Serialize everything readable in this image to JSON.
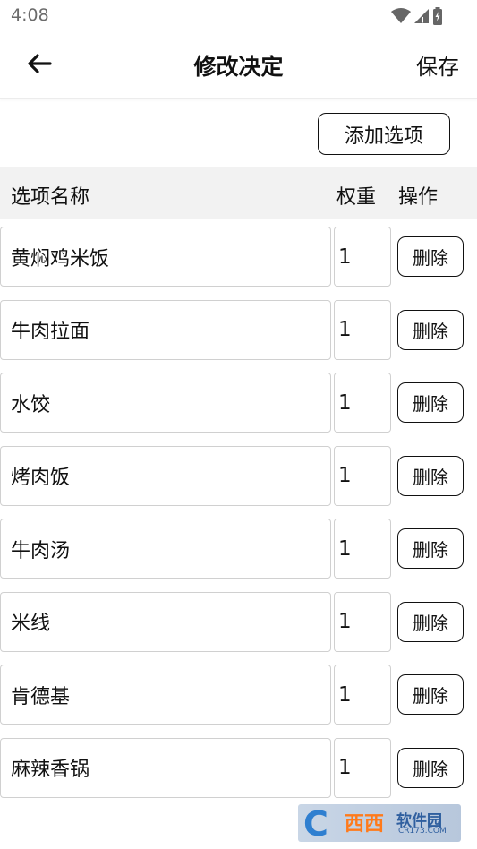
{
  "status_bar": {
    "time": "4:08",
    "icons": [
      "wifi-icon",
      "signal-icon",
      "battery-icon"
    ]
  },
  "app_bar": {
    "back_icon": "arrow-left-icon",
    "title": "修改决定",
    "save_label": "保存"
  },
  "toolbar": {
    "add_option_label": "添加选项"
  },
  "table": {
    "headers": {
      "name": "选项名称",
      "weight": "权重",
      "action": "操作"
    },
    "delete_label": "删除",
    "rows": [
      {
        "name": "黄焖鸡米饭",
        "weight": "1"
      },
      {
        "name": "牛肉拉面",
        "weight": "1"
      },
      {
        "name": "水饺",
        "weight": "1"
      },
      {
        "name": "烤肉饭",
        "weight": "1"
      },
      {
        "name": "牛肉汤",
        "weight": "1"
      },
      {
        "name": "米线",
        "weight": "1"
      },
      {
        "name": "肯德基",
        "weight": "1"
      },
      {
        "name": "麻辣香锅",
        "weight": "1"
      }
    ]
  },
  "watermark": {
    "mark": "C",
    "main": "西西",
    "side": "软件园",
    "sub": "CR173.COM"
  },
  "colors": {
    "text": "#111111",
    "status_text": "#6b6b6b",
    "header_bg": "#f2f2f2",
    "field_border": "#d0d0d0"
  }
}
